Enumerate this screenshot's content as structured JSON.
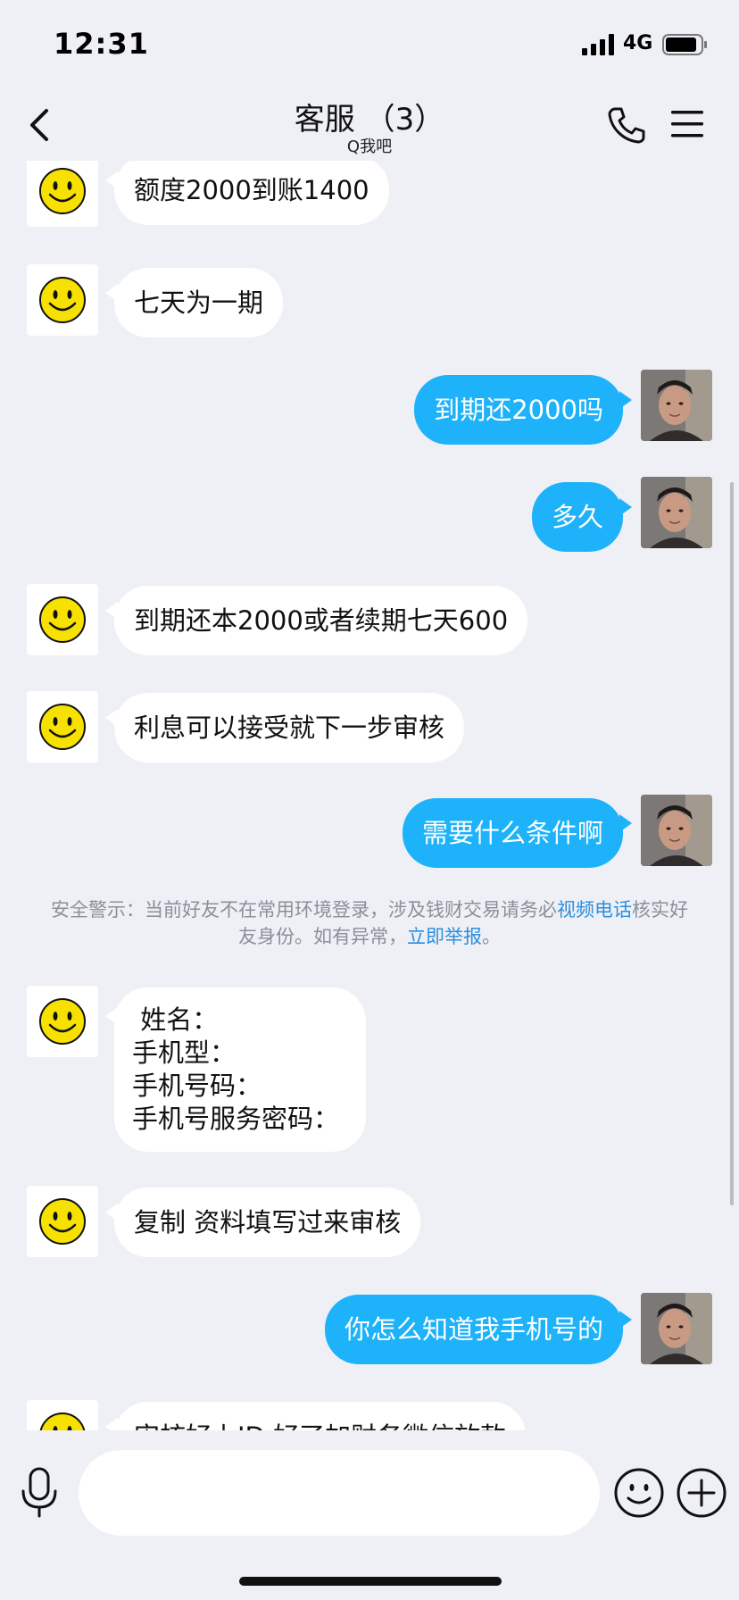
{
  "status_bar": {
    "time": "12:31",
    "network": "4G"
  },
  "nav": {
    "title": "客服 （3）",
    "subtitle": "Q我吧"
  },
  "messages": [
    {
      "from": "agent",
      "text": "额度2000到账1400"
    },
    {
      "from": "agent",
      "text": "七天为一期"
    },
    {
      "from": "user",
      "text": "到期还2000吗"
    },
    {
      "from": "user",
      "text": "多久"
    },
    {
      "from": "agent",
      "text": "到期还本2000或者续期七天600"
    },
    {
      "from": "agent",
      "text": "利息可以接受就下一步审核"
    },
    {
      "from": "user",
      "text": "需要什么条件啊"
    },
    {
      "from": "agent",
      "lines": [
        " 姓名：",
        "手机型：",
        "手机号码：",
        "手机号服务密码："
      ]
    },
    {
      "from": "agent",
      "text": "复制 资料填写过来审核"
    },
    {
      "from": "user",
      "text": "你怎么知道我手机号的"
    },
    {
      "from": "agent",
      "text": "审核好上ID 好了加财务微信放款"
    }
  ],
  "notice": {
    "prefix": "安全警示：当前好友不在常用环境登录，涉及钱财交易请务必",
    "link1": "视频电话",
    "middle": "核实好友身份。如有异常，",
    "link2": "立即举报",
    "suffix": "。"
  },
  "input": {
    "placeholder": ""
  },
  "colors": {
    "outgoing_bubble": "#1db2f9",
    "incoming_bubble": "#ffffff",
    "background": "#eef0f6",
    "link": "#2b8fe0"
  },
  "icons": [
    "back-icon",
    "phone-icon",
    "menu-icon",
    "mic-icon",
    "emoji-icon",
    "plus-icon",
    "smiley-avatar",
    "signal-icon",
    "battery-icon"
  ]
}
